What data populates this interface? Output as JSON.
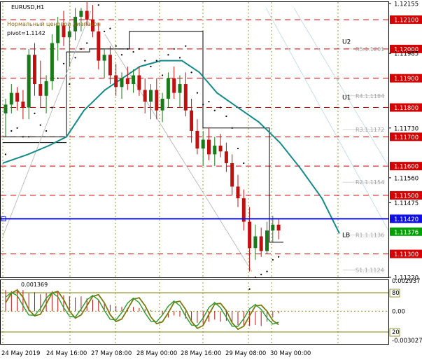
{
  "chart_data": {
    "type": "candlestick",
    "symbol_label": "EURUSD,H1",
    "indicator_title": "Нормальный ценовой диапазон",
    "pivot_label": "pivot=1.1142",
    "ylim": [
      1.1122,
      1.1216
    ],
    "price_ticks": [
      "1.12155",
      "1.12100",
      "1.12000",
      "1.11985",
      "1.11900",
      "1.11800",
      "1.11730",
      "1.11700",
      "1.11600",
      "1.11560",
      "1.11500",
      "1.11475",
      "1.11420",
      "1.11376",
      "1.11300",
      "1.11220"
    ],
    "highlighted_levels": [
      {
        "price": 1.121,
        "label": "1.12100",
        "color": "#d40000"
      },
      {
        "price": 1.12,
        "label": "1.12000",
        "color": "#d40000"
      },
      {
        "price": 1.119,
        "label": "1.11900",
        "color": "#d40000"
      },
      {
        "price": 1.118,
        "label": "1.11800",
        "color": "#d40000"
      },
      {
        "price": 1.117,
        "label": "1.11700",
        "color": "#d40000"
      },
      {
        "price": 1.116,
        "label": "1.11600",
        "color": "#d40000"
      },
      {
        "price": 1.115,
        "label": "1.11500",
        "color": "#d40000"
      },
      {
        "price": 1.1142,
        "label": "1.11420",
        "color": "#1010e0"
      },
      {
        "price": 1.11376,
        "label": "1.11376",
        "color": "#00a000"
      },
      {
        "price": 1.113,
        "label": "1.11300",
        "color": "#d40000"
      }
    ],
    "pivot_labels": [
      {
        "label": "R5.1.1201",
        "price": 1.12
      },
      {
        "label": "R4.1.1184",
        "price": 1.1184
      },
      {
        "label": "R3.1.1172",
        "price": 1.11725
      },
      {
        "label": "R2.1.1154",
        "price": 1.11545
      },
      {
        "label": "R1.1.1136",
        "price": 1.11365
      },
      {
        "label": "S1.1.1124",
        "price": 1.11245
      }
    ],
    "band_labels": [
      {
        "label": "U2",
        "price": 1.12025
      },
      {
        "label": "U1",
        "price": 1.11835
      },
      {
        "label": "LB",
        "price": 1.11365
      }
    ],
    "x_labels": [
      "24 May 2019",
      "24 May 16:00",
      "27 May 08:00",
      "28 May 00:00",
      "28 May 16:00",
      "29 May 08:00",
      "30 May 00:00"
    ],
    "candles_ohlc": [
      [
        1.1178,
        1.1183,
        1.117,
        1.1181
      ],
      [
        1.1181,
        1.1188,
        1.1178,
        1.1185
      ],
      [
        1.1185,
        1.1187,
        1.1179,
        1.1182
      ],
      [
        1.1182,
        1.1186,
        1.1176,
        1.118
      ],
      [
        1.118,
        1.12,
        1.1176,
        1.1198
      ],
      [
        1.1198,
        1.1202,
        1.1184,
        1.1188
      ],
      [
        1.1188,
        1.1196,
        1.118,
        1.1184
      ],
      [
        1.1184,
        1.1191,
        1.1178,
        1.1189
      ],
      [
        1.1189,
        1.1205,
        1.1186,
        1.1202
      ],
      [
        1.1202,
        1.1211,
        1.1196,
        1.1208
      ],
      [
        1.1208,
        1.1213,
        1.1201,
        1.1204
      ],
      [
        1.1204,
        1.1208,
        1.1194,
        1.1206
      ],
      [
        1.1206,
        1.1214,
        1.1203,
        1.1211
      ],
      [
        1.1211,
        1.1214,
        1.1206,
        1.1213
      ],
      [
        1.1213,
        1.1216,
        1.1208,
        1.121
      ],
      [
        1.121,
        1.1215,
        1.1204,
        1.1206
      ],
      [
        1.1206,
        1.1209,
        1.1193,
        1.1196
      ],
      [
        1.1196,
        1.12,
        1.119,
        1.1198
      ],
      [
        1.1198,
        1.1201,
        1.1188,
        1.1191
      ],
      [
        1.1191,
        1.1195,
        1.1184,
        1.1187
      ],
      [
        1.1187,
        1.1192,
        1.1183,
        1.119
      ],
      [
        1.119,
        1.1194,
        1.1186,
        1.1188
      ],
      [
        1.1188,
        1.1193,
        1.1185,
        1.1191
      ],
      [
        1.1191,
        1.1194,
        1.1184,
        1.1186
      ],
      [
        1.1186,
        1.119,
        1.1178,
        1.1182
      ],
      [
        1.1182,
        1.1188,
        1.1176,
        1.1186
      ],
      [
        1.1186,
        1.119,
        1.1176,
        1.1179
      ],
      [
        1.1179,
        1.1185,
        1.1175,
        1.1183
      ],
      [
        1.1183,
        1.1192,
        1.118,
        1.119
      ],
      [
        1.119,
        1.1194,
        1.1183,
        1.1185
      ],
      [
        1.1185,
        1.1191,
        1.118,
        1.1188
      ],
      [
        1.1188,
        1.1192,
        1.1177,
        1.1179
      ],
      [
        1.1179,
        1.1183,
        1.1168,
        1.1172
      ],
      [
        1.1172,
        1.1176,
        1.1164,
        1.1166
      ],
      [
        1.1166,
        1.1172,
        1.116,
        1.1169
      ],
      [
        1.1169,
        1.1173,
        1.1162,
        1.1164
      ],
      [
        1.1164,
        1.117,
        1.116,
        1.1167
      ],
      [
        1.1167,
        1.1171,
        1.1163,
        1.1165
      ],
      [
        1.1165,
        1.1168,
        1.1158,
        1.1161
      ],
      [
        1.1161,
        1.1164,
        1.115,
        1.1153
      ],
      [
        1.1153,
        1.1157,
        1.1146,
        1.1149
      ],
      [
        1.1149,
        1.1152,
        1.1138,
        1.1141
      ],
      [
        1.1141,
        1.1146,
        1.1124,
        1.1132
      ],
      [
        1.1132,
        1.114,
        1.1128,
        1.1136
      ],
      [
        1.1136,
        1.1139,
        1.1129,
        1.1131
      ],
      [
        1.1131,
        1.1141,
        1.113,
        1.1138
      ],
      [
        1.1138,
        1.1143,
        1.1134,
        1.114
      ],
      [
        1.114,
        1.1142,
        1.1135,
        1.1138
      ]
    ],
    "oscillator": {
      "ylim": [
        -0.003027,
        0.002937
      ],
      "tick_labels": [
        "0.002937",
        "80",
        "0.00",
        "20",
        "-0.003027"
      ],
      "value_label": "0.001369",
      "hist_values": [
        0.002,
        0.0019,
        0.0021,
        0.002,
        0.0017,
        0.0018,
        0.0016,
        0.0017,
        0.0019,
        0.0018,
        0.0015,
        0.0014,
        0.0013,
        0.0014,
        0.0012,
        0.0011,
        0.001,
        0.0008,
        0.0006,
        0.0005,
        0.0004,
        0.0003,
        0.0004,
        0.0003,
        0.0002,
        0.0001,
        0.0,
        -0.0003,
        -0.0006,
        -0.0004,
        -0.0005,
        -0.0007,
        -0.0009,
        -0.0011,
        -0.0012,
        -0.001,
        -0.0008,
        -0.001,
        -0.0009,
        -0.0012,
        -0.0013,
        -0.0014,
        -0.0014,
        -0.0013,
        -0.0014,
        -0.001,
        -0.0006,
        -0.0002
      ]
    }
  }
}
